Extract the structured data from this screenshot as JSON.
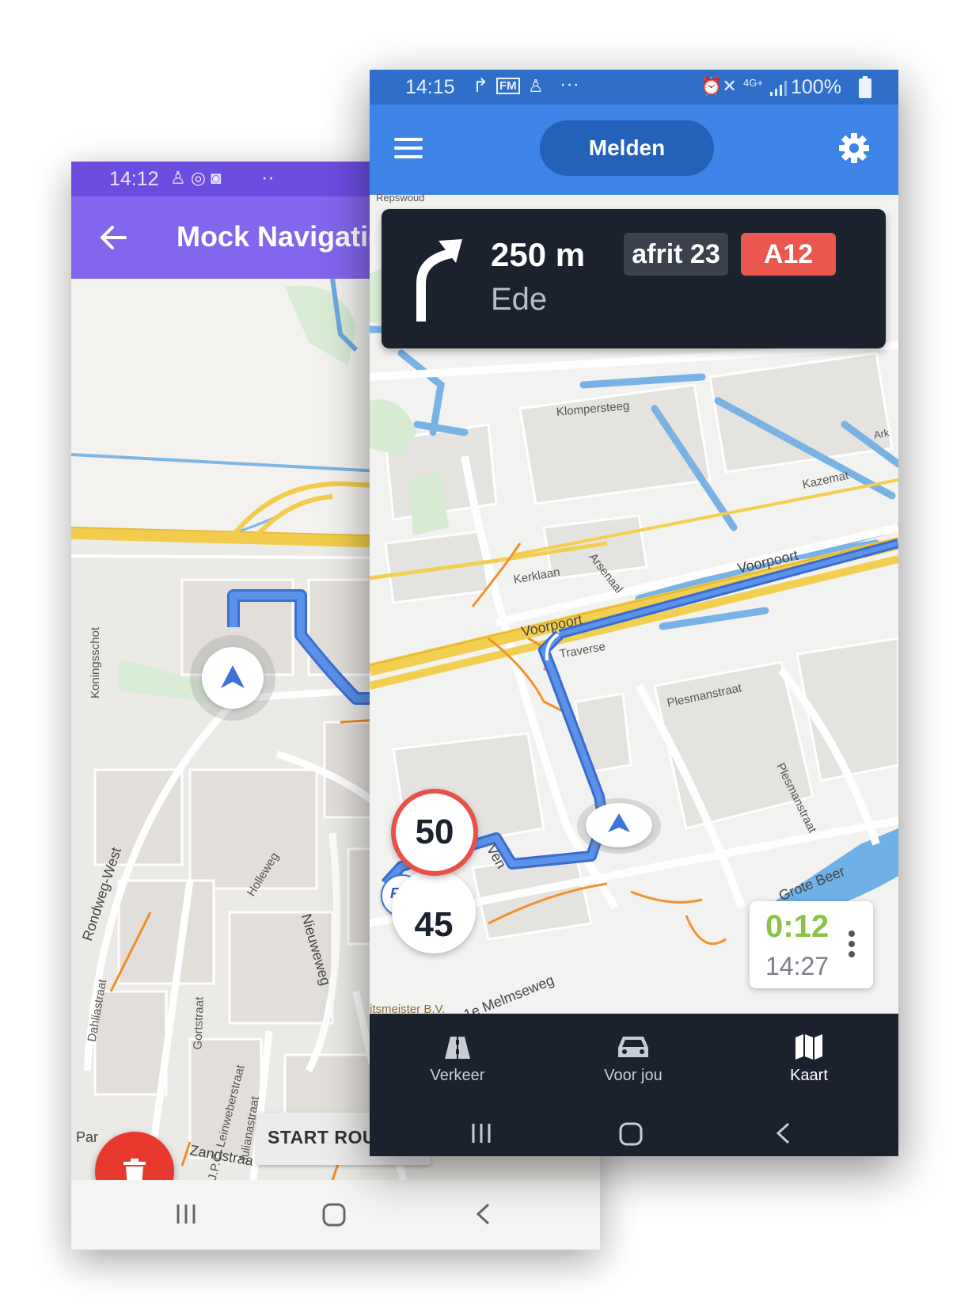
{
  "back_phone": {
    "status": {
      "time": "14:12",
      "icons_text": "··"
    },
    "appbar": {
      "title": "Mock Navigatic"
    },
    "map_labels": [
      "Koningsschot",
      "Rondweg-West",
      "Dahliastraat",
      "Gortstraat",
      "J.P.C. Leinweberstraat",
      "Julianastraat",
      "Holleweg",
      "Nieuweweg",
      "Zandstraa",
      "Par"
    ],
    "start_button": "START ROU",
    "colors": {
      "status": "#6d4de0",
      "appbar": "#8465ee",
      "fab": "#e8392e"
    }
  },
  "front_phone": {
    "status": {
      "time": "14:15",
      "fm": "FM",
      "dots": "···",
      "network": "4G+",
      "battery": "100%"
    },
    "appbar": {
      "report_button": "Melden"
    },
    "instruction": {
      "distance": "250 m",
      "destination": "Ede",
      "exit": "afrit 23",
      "road": "A12"
    },
    "map_labels": [
      "Repswoud",
      "Klompersteeg",
      "Kazemat",
      "Ark",
      "Kerklaan",
      "Arsenaal",
      "Voorpoort",
      "Voorpoort",
      "Traverse",
      "Plesmanstraat",
      "Plesmanstraat",
      "Ven",
      "Grote Beer",
      "1e Melmseweg",
      "itsmeister B.V."
    ],
    "speed_limit": "50",
    "current_speed": "45",
    "provider_badge": "FM",
    "eta": {
      "remaining": "0:12",
      "arrival": "14:27"
    },
    "tabs": [
      {
        "label": "Verkeer",
        "icon": "road-icon"
      },
      {
        "label": "Voor jou",
        "icon": "car-icon"
      },
      {
        "label": "Kaart",
        "icon": "map-icon"
      }
    ],
    "colors": {
      "status": "#2f6fc9",
      "appbar": "#3d84e6",
      "panel": "#1c212e",
      "road_badge": "#e9574f",
      "route": "#4a7fe0",
      "eta_remaining": "#8bc34a"
    }
  }
}
